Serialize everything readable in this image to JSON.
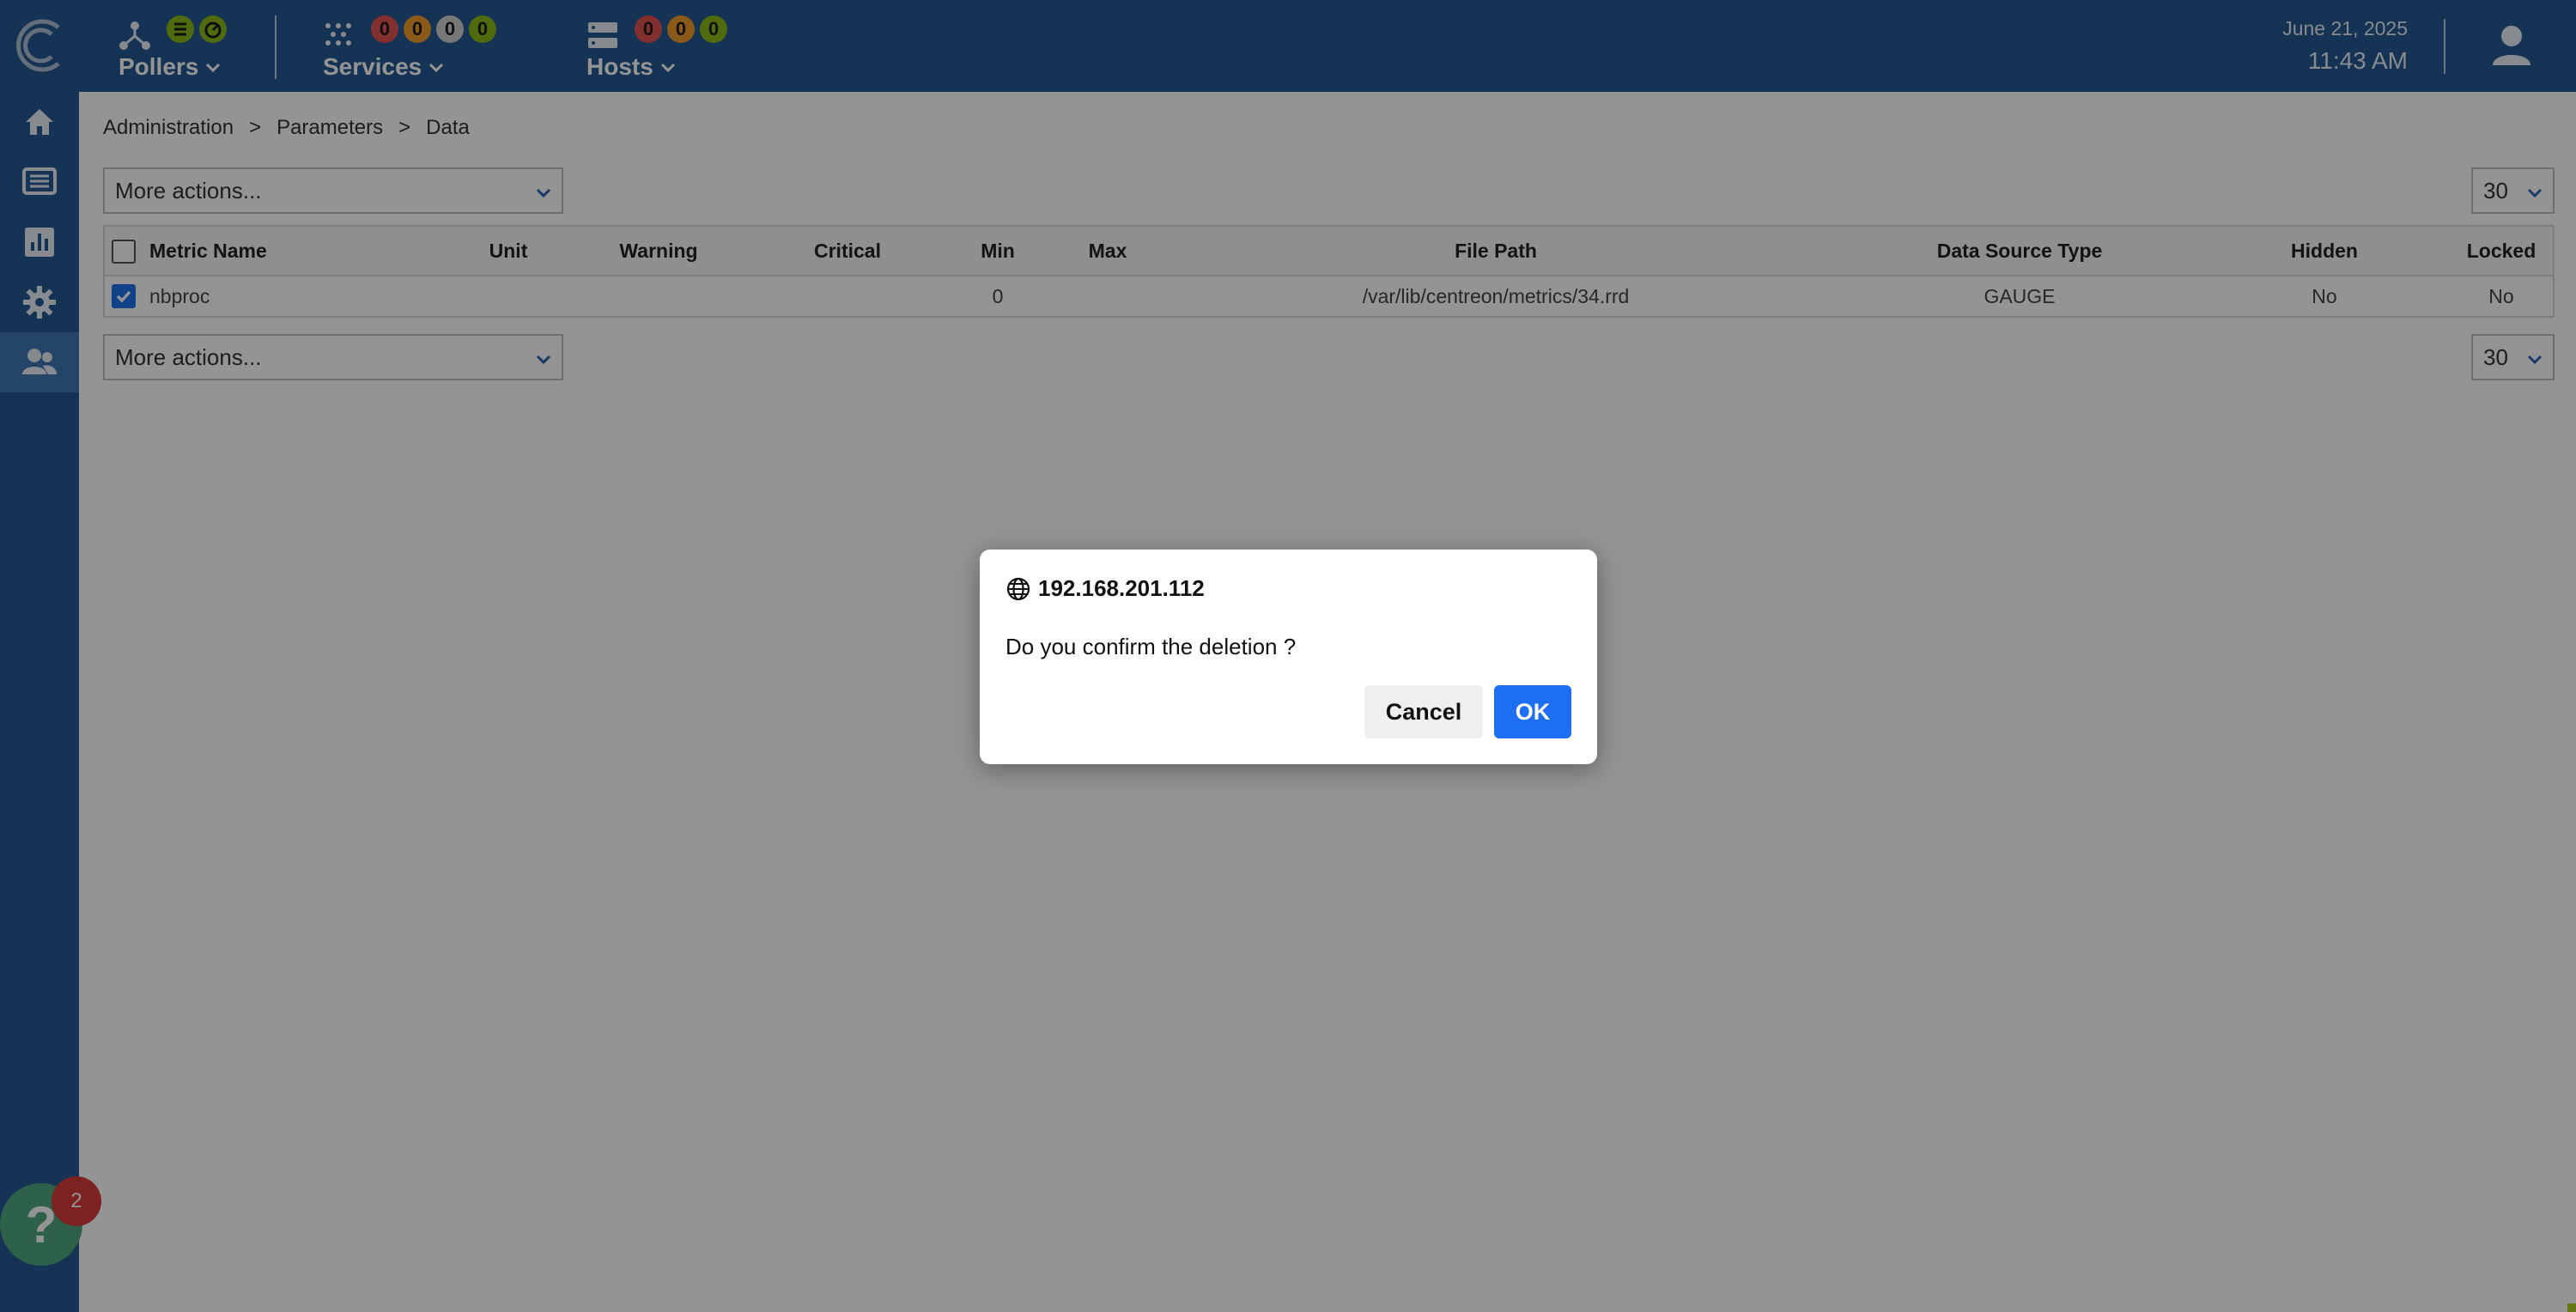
{
  "topbar": {
    "pollers": {
      "label": "Pollers"
    },
    "services": {
      "label": "Services",
      "counters": [
        "0",
        "0",
        "0",
        "0"
      ]
    },
    "hosts": {
      "label": "Hosts",
      "counters": [
        "0",
        "0",
        "0"
      ]
    },
    "date": "June 21, 2025",
    "time": "11:43 AM"
  },
  "sidebar": {
    "items": [
      "home-icon",
      "monitoring-icon",
      "reporting-icon",
      "configuration-icon",
      "administration-icon"
    ],
    "active": "administration-icon"
  },
  "breadcrumb": [
    "Administration",
    ">",
    "Parameters",
    ">",
    "Data"
  ],
  "actions": {
    "top": "More actions...",
    "bottom": "More actions..."
  },
  "pagination": {
    "top": "30",
    "bottom": "30"
  },
  "table": {
    "headers": {
      "metric_name": "Metric Name",
      "unit": "Unit",
      "warning": "Warning",
      "critical": "Critical",
      "min": "Min",
      "max": "Max",
      "file_path": "File Path",
      "data_source_type": "Data Source Type",
      "hidden": "Hidden",
      "locked": "Locked"
    },
    "rows": [
      {
        "checked": true,
        "metric_name": "nbproc",
        "unit": "",
        "warning": "",
        "critical": "",
        "min": "0",
        "max": "",
        "file_path": "/var/lib/centreon/metrics/34.rrd",
        "data_source_type": "GAUGE",
        "hidden": "No",
        "locked": "No"
      }
    ]
  },
  "dialog": {
    "title": "192.168.201.112",
    "message": "Do you confirm the deletion ?",
    "cancel": "Cancel",
    "ok": "OK"
  },
  "help": {
    "icon": "?",
    "badge": "2"
  },
  "colors": {
    "header": "#255891",
    "active": "#3f75b3",
    "ok_button": "#1c6ef2",
    "help": "#4fa87e",
    "badge": "#d73a3a"
  }
}
